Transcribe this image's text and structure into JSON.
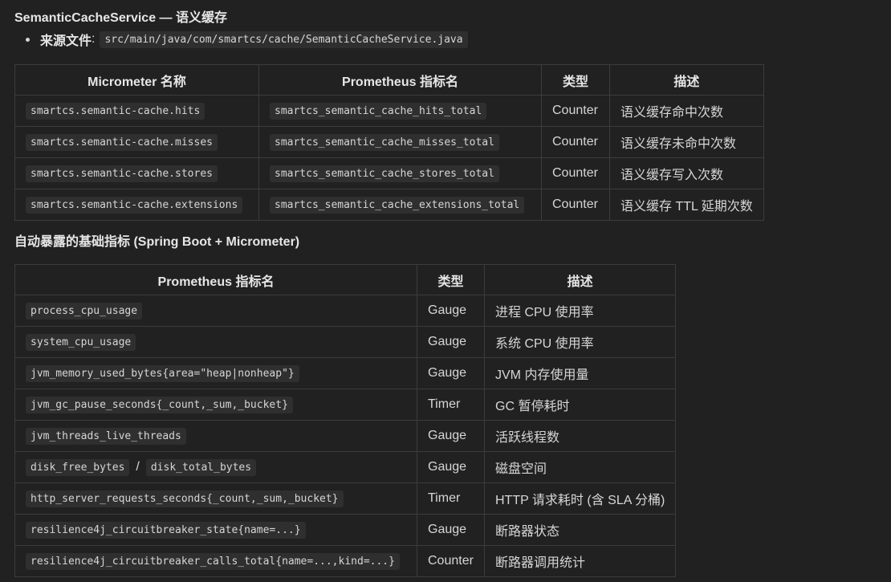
{
  "section_title": "SemanticCacheService — 语义缓存",
  "source": {
    "label": "来源文件",
    "colon": ":",
    "path": "src/main/java/com/smartcs/cache/SemanticCacheService.java"
  },
  "table1": {
    "headers": [
      "Micrometer 名称",
      "Prometheus 指标名",
      "类型",
      "描述"
    ],
    "rows": [
      [
        "smartcs.semantic-cache.hits",
        "smartcs_semantic_cache_hits_total",
        "Counter",
        "语义缓存命中次数"
      ],
      [
        "smartcs.semantic-cache.misses",
        "smartcs_semantic_cache_misses_total",
        "Counter",
        "语义缓存未命中次数"
      ],
      [
        "smartcs.semantic-cache.stores",
        "smartcs_semantic_cache_stores_total",
        "Counter",
        "语义缓存写入次数"
      ],
      [
        "smartcs.semantic-cache.extensions",
        "smartcs_semantic_cache_extensions_total",
        "Counter",
        "语义缓存 TTL 延期次数"
      ]
    ]
  },
  "subtitle": "自动暴露的基础指标 (Spring Boot + Micrometer)",
  "table2": {
    "headers": [
      "Prometheus 指标名",
      "类型",
      "描述"
    ],
    "rows": [
      {
        "metrics": [
          "process_cpu_usage"
        ],
        "type": "Gauge",
        "desc": "进程 CPU 使用率"
      },
      {
        "metrics": [
          "system_cpu_usage"
        ],
        "type": "Gauge",
        "desc": "系统 CPU 使用率"
      },
      {
        "metrics": [
          "jvm_memory_used_bytes{area=\"heap|nonheap\"}"
        ],
        "type": "Gauge",
        "desc": "JVM 内存使用量"
      },
      {
        "metrics": [
          "jvm_gc_pause_seconds{_count,_sum,_bucket}"
        ],
        "type": "Timer",
        "desc": "GC 暂停耗时"
      },
      {
        "metrics": [
          "jvm_threads_live_threads"
        ],
        "type": "Gauge",
        "desc": "活跃线程数"
      },
      {
        "metrics": [
          "disk_free_bytes",
          "disk_total_bytes"
        ],
        "sep": "/",
        "type": "Gauge",
        "desc": "磁盘空间"
      },
      {
        "metrics": [
          "http_server_requests_seconds{_count,_sum,_bucket}"
        ],
        "type": "Timer",
        "desc": "HTTP 请求耗时 (含 SLA 分桶)"
      },
      {
        "metrics": [
          "resilience4j_circuitbreaker_state{name=...}"
        ],
        "type": "Gauge",
        "desc": "断路器状态"
      },
      {
        "metrics": [
          "resilience4j_circuitbreaker_calls_total{name=...,kind=...}"
        ],
        "type": "Counter",
        "desc": "断路器调用统计"
      }
    ]
  }
}
